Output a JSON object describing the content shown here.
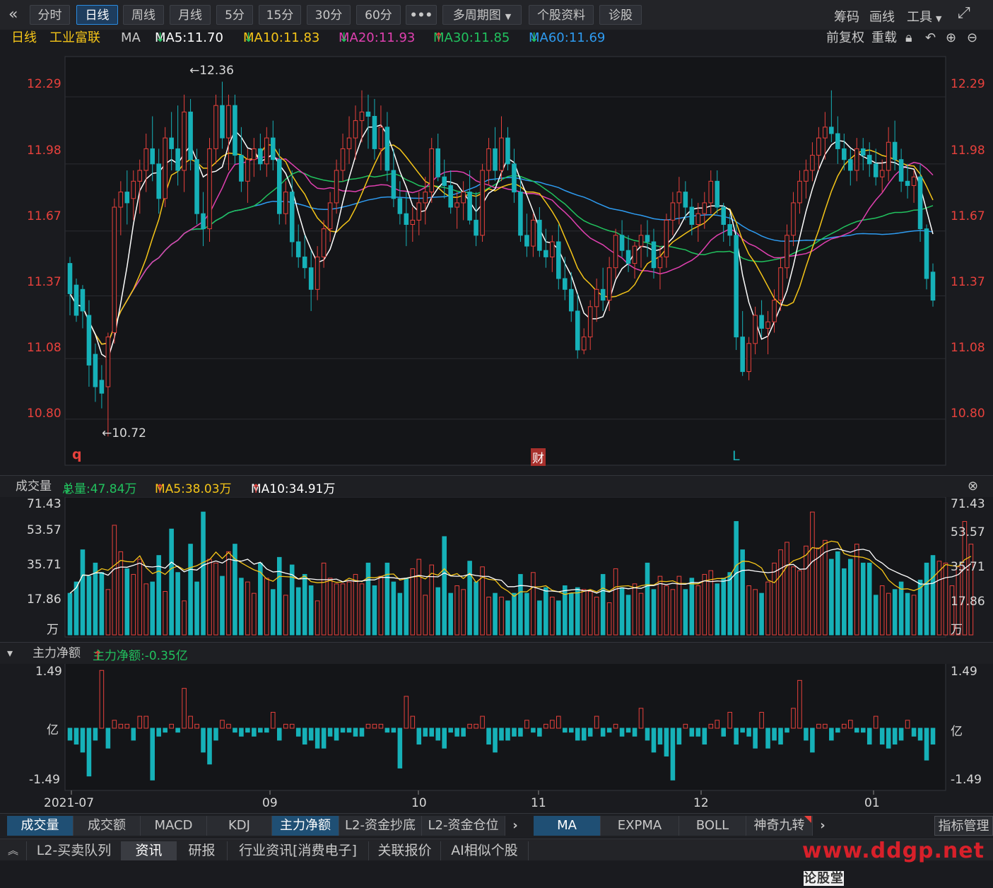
{
  "toolbar": {
    "collapse_icon": "double-chevron-left-icon",
    "buttons": [
      "分时",
      "日线",
      "周线",
      "月线",
      "5分",
      "15分",
      "30分",
      "60分",
      "•••",
      "多周期图",
      "个股资料",
      "诊股"
    ],
    "active": "日线",
    "right": [
      "筹码",
      "画线",
      "工具"
    ],
    "fullscreen_icon": "expand-icon"
  },
  "legend": {
    "period": "日线",
    "stock": "工业富联",
    "indicator": "MA",
    "ma5": "MA5:11.70",
    "ma10": "MA10:11.83",
    "ma20": "MA20:11.93",
    "ma30": "MA30:11.85",
    "ma60": "MA60:11.69",
    "adjust": "前复权",
    "reload": "重载",
    "colors": {
      "ma5": "#ffffff",
      "ma10": "#f5c518",
      "ma20": "#e040b0",
      "ma30": "#21c25e",
      "ma60": "#2e9bf0",
      "up": "#e8413c",
      "down": "#16b1b8"
    }
  },
  "price_axis": {
    "ticks": [
      "12.29",
      "11.98",
      "11.67",
      "11.37",
      "11.08",
      "10.80"
    ]
  },
  "annotations": {
    "high": "←12.36",
    "low": "←10.72",
    "marker_q": "q",
    "marker_cai": "财",
    "marker_l": "L"
  },
  "volume": {
    "title": "成交量",
    "total": "总量:47.84万",
    "ma5": "MA5:38.03万",
    "ma10": "MA10:34.91万",
    "ticks": [
      "71.43",
      "53.57",
      "35.71",
      "17.86"
    ],
    "unit": "万"
  },
  "netflow": {
    "title": "主力净额",
    "value": "主力净额:-0.35亿",
    "ticks": [
      "1.49",
      "-1.49"
    ],
    "unit": "亿"
  },
  "x_axis": {
    "labels": [
      "2021-07",
      "09",
      "10",
      "11",
      "12",
      "01"
    ]
  },
  "indicator_tabs": [
    "成交量",
    "成交额",
    "MACD",
    "KDJ",
    "主力净额",
    "L2-资金抄底",
    "L2-资金仓位"
  ],
  "indicator_active": [
    "成交量",
    "主力净额"
  ],
  "ma_tabs": [
    "MA",
    "EXPMA",
    "BOLL",
    "神奇九转"
  ],
  "ma_active": "MA",
  "index_manage": "指标管理",
  "bottom_tabs": [
    "L2-买卖队列",
    "资讯",
    "研报",
    "行业资讯[消费电子]",
    "关联报价",
    "AI相似个股"
  ],
  "bottom_active": "资讯",
  "watermark": "www.ddgp.net",
  "watermark_tail": "论股堂",
  "chart_data": {
    "type": "candlestick",
    "ylim": [
      10.62,
      12.45
    ],
    "candles": [
      [
        11.52,
        11.55,
        11.28,
        11.38
      ],
      [
        11.42,
        11.45,
        11.25,
        11.28
      ],
      [
        11.4,
        11.42,
        11.22,
        11.3
      ],
      [
        11.28,
        11.35,
        10.95,
        11.05
      ],
      [
        11.1,
        11.15,
        10.88,
        10.95
      ],
      [
        10.98,
        11.05,
        10.85,
        10.92
      ],
      [
        10.95,
        11.2,
        10.72,
        11.18
      ],
      [
        11.2,
        11.82,
        11.15,
        11.78
      ],
      [
        11.78,
        11.9,
        11.65,
        11.85
      ],
      [
        11.85,
        11.95,
        11.7,
        11.8
      ],
      [
        11.82,
        11.95,
        11.72,
        11.9
      ],
      [
        11.9,
        12.0,
        11.75,
        11.95
      ],
      [
        11.95,
        12.12,
        11.85,
        12.05
      ],
      [
        12.05,
        12.2,
        11.9,
        11.98
      ],
      [
        11.98,
        12.05,
        11.75,
        11.82
      ],
      [
        11.82,
        12.15,
        11.78,
        12.1
      ],
      [
        12.1,
        12.22,
        11.95,
        12.05
      ],
      [
        12.05,
        12.25,
        11.88,
        11.95
      ],
      [
        11.95,
        12.3,
        11.85,
        12.22
      ],
      [
        12.22,
        12.28,
        11.95,
        12.0
      ],
      [
        12.0,
        12.05,
        11.7,
        11.75
      ],
      [
        11.75,
        11.85,
        11.6,
        11.68
      ],
      [
        11.68,
        12.1,
        11.62,
        12.05
      ],
      [
        12.05,
        12.3,
        11.98,
        12.25
      ],
      [
        12.25,
        12.36,
        12.05,
        12.1
      ],
      [
        12.1,
        12.3,
        11.95,
        12.25
      ],
      [
        12.25,
        12.3,
        11.98,
        12.02
      ],
      [
        12.02,
        12.15,
        11.85,
        11.9
      ],
      [
        11.9,
        12.05,
        11.8,
        12.0
      ],
      [
        12.0,
        12.1,
        11.92,
        12.05
      ],
      [
        12.05,
        12.12,
        11.95,
        11.98
      ],
      [
        11.98,
        12.15,
        11.92,
        12.1
      ],
      [
        12.1,
        12.18,
        11.95,
        12.0
      ],
      [
        12.0,
        12.05,
        11.7,
        11.75
      ],
      [
        11.75,
        11.9,
        11.7,
        11.85
      ],
      [
        11.85,
        11.95,
        11.55,
        11.62
      ],
      [
        11.62,
        11.7,
        11.5,
        11.55
      ],
      [
        11.55,
        11.65,
        11.45,
        11.5
      ],
      [
        11.5,
        11.58,
        11.3,
        11.4
      ],
      [
        11.4,
        11.6,
        11.35,
        11.55
      ],
      [
        11.55,
        11.72,
        11.5,
        11.68
      ],
      [
        11.68,
        11.85,
        11.62,
        11.8
      ],
      [
        11.8,
        12.0,
        11.75,
        11.95
      ],
      [
        11.95,
        12.12,
        11.9,
        12.05
      ],
      [
        12.05,
        12.2,
        11.98,
        12.1
      ],
      [
        12.1,
        12.25,
        12.0,
        12.18
      ],
      [
        12.18,
        12.32,
        12.08,
        12.22
      ],
      [
        12.22,
        12.3,
        12.05,
        12.2
      ],
      [
        12.2,
        12.28,
        12.0,
        12.05
      ],
      [
        12.05,
        12.25,
        11.95,
        12.15
      ],
      [
        12.15,
        12.22,
        11.9,
        11.95
      ],
      [
        11.95,
        12.05,
        11.78,
        11.82
      ],
      [
        11.82,
        11.9,
        11.7,
        11.75
      ],
      [
        11.75,
        11.85,
        11.6,
        11.7
      ],
      [
        11.7,
        11.78,
        11.62,
        11.72
      ],
      [
        11.72,
        11.85,
        11.65,
        11.8
      ],
      [
        11.8,
        11.92,
        11.7,
        11.85
      ],
      [
        11.85,
        12.1,
        11.8,
        12.05
      ],
      [
        12.05,
        12.12,
        11.9,
        11.92
      ],
      [
        11.92,
        12.0,
        11.82,
        11.88
      ],
      [
        11.88,
        11.95,
        11.75,
        11.78
      ],
      [
        11.78,
        11.85,
        11.68,
        11.8
      ],
      [
        11.8,
        11.9,
        11.72,
        11.85
      ],
      [
        11.85,
        11.95,
        11.7,
        11.72
      ],
      [
        11.72,
        11.85,
        11.6,
        11.65
      ],
      [
        11.65,
        11.98,
        11.62,
        11.95
      ],
      [
        11.95,
        12.1,
        11.88,
        12.05
      ],
      [
        12.05,
        12.15,
        11.9,
        11.95
      ],
      [
        11.95,
        12.2,
        11.9,
        12.1
      ],
      [
        12.1,
        12.15,
        11.95,
        11.98
      ],
      [
        11.98,
        12.05,
        11.8,
        11.85
      ],
      [
        11.85,
        11.92,
        11.62,
        11.65
      ],
      [
        11.65,
        11.75,
        11.55,
        11.6
      ],
      [
        11.6,
        11.75,
        11.55,
        11.72
      ],
      [
        11.72,
        11.78,
        11.55,
        11.58
      ],
      [
        11.58,
        11.68,
        11.5,
        11.55
      ],
      [
        11.55,
        11.65,
        11.48,
        11.62
      ],
      [
        11.62,
        11.7,
        11.4,
        11.45
      ],
      [
        11.45,
        11.55,
        11.35,
        11.4
      ],
      [
        11.4,
        11.48,
        11.25,
        11.3
      ],
      [
        11.3,
        11.38,
        11.08,
        11.12
      ],
      [
        11.12,
        11.22,
        11.1,
        11.18
      ],
      [
        11.18,
        11.35,
        11.12,
        11.32
      ],
      [
        11.32,
        11.45,
        11.25,
        11.4
      ],
      [
        11.4,
        11.5,
        11.3,
        11.35
      ],
      [
        11.35,
        11.55,
        11.3,
        11.5
      ],
      [
        11.5,
        11.68,
        11.45,
        11.65
      ],
      [
        11.65,
        11.72,
        11.55,
        11.58
      ],
      [
        11.58,
        11.65,
        11.48,
        11.52
      ],
      [
        11.52,
        11.62,
        11.45,
        11.6
      ],
      [
        11.6,
        11.7,
        11.5,
        11.65
      ],
      [
        11.65,
        11.72,
        11.55,
        11.62
      ],
      [
        11.62,
        11.68,
        11.45,
        11.5
      ],
      [
        11.5,
        11.6,
        11.4,
        11.55
      ],
      [
        11.55,
        11.75,
        11.5,
        11.72
      ],
      [
        11.72,
        11.85,
        11.65,
        11.8
      ],
      [
        11.8,
        11.92,
        11.7,
        11.85
      ],
      [
        11.85,
        11.9,
        11.72,
        11.78
      ],
      [
        11.78,
        11.82,
        11.65,
        11.7
      ],
      [
        11.7,
        11.8,
        11.62,
        11.75
      ],
      [
        11.75,
        11.85,
        11.68,
        11.8
      ],
      [
        11.8,
        11.95,
        11.75,
        11.9
      ],
      [
        11.9,
        11.95,
        11.75,
        11.78
      ],
      [
        11.78,
        11.8,
        11.62,
        11.7
      ],
      [
        11.7,
        11.75,
        11.6,
        11.65
      ],
      [
        11.65,
        11.7,
        11.12,
        11.18
      ],
      [
        11.18,
        11.3,
        11.0,
        11.02
      ],
      [
        11.02,
        11.18,
        10.98,
        11.15
      ],
      [
        11.15,
        11.32,
        11.1,
        11.28
      ],
      [
        11.28,
        11.35,
        11.18,
        11.22
      ],
      [
        11.22,
        11.3,
        11.1,
        11.25
      ],
      [
        11.25,
        11.4,
        11.2,
        11.35
      ],
      [
        11.35,
        11.55,
        11.3,
        11.5
      ],
      [
        11.5,
        11.7,
        11.45,
        11.65
      ],
      [
        11.65,
        11.85,
        11.6,
        11.8
      ],
      [
        11.8,
        11.95,
        11.75,
        11.9
      ],
      [
        11.9,
        12.0,
        11.82,
        11.95
      ],
      [
        11.95,
        12.08,
        11.9,
        12.02
      ],
      [
        12.02,
        12.15,
        11.95,
        12.1
      ],
      [
        12.1,
        12.22,
        12.0,
        12.15
      ],
      [
        12.15,
        12.32,
        12.08,
        12.12
      ],
      [
        12.12,
        12.2,
        11.98,
        12.05
      ],
      [
        12.05,
        12.12,
        11.95,
        12.0
      ],
      [
        12.0,
        12.05,
        11.88,
        11.95
      ],
      [
        11.95,
        12.1,
        11.9,
        12.05
      ],
      [
        12.05,
        12.1,
        11.95,
        12.02
      ],
      [
        12.02,
        12.08,
        11.92,
        11.98
      ],
      [
        11.98,
        12.05,
        11.88,
        11.92
      ],
      [
        11.92,
        12.0,
        11.85,
        11.95
      ],
      [
        11.95,
        12.15,
        11.9,
        12.08
      ],
      [
        12.08,
        12.18,
        11.95,
        12.0
      ],
      [
        12.0,
        12.05,
        11.85,
        11.9
      ],
      [
        11.9,
        11.98,
        11.82,
        11.88
      ],
      [
        11.88,
        11.95,
        11.8,
        11.92
      ],
      [
        11.92,
        11.98,
        11.62,
        11.68
      ],
      [
        11.68,
        11.7,
        11.4,
        11.45
      ],
      [
        11.48,
        11.52,
        11.32,
        11.35
      ]
    ],
    "volume_wan": [
      22,
      28,
      45,
      31,
      38,
      33,
      24,
      58,
      44,
      35,
      32,
      40,
      27,
      28,
      42,
      23,
      56,
      33,
      18,
      48,
      28,
      65,
      40,
      38,
      31,
      44,
      48,
      30,
      28,
      22,
      38,
      30,
      24,
      41,
      21,
      37,
      25,
      32,
      26,
      18,
      38,
      30,
      27,
      27,
      28,
      32,
      27,
      38,
      26,
      31,
      38,
      28,
      22,
      30,
      35,
      40,
      21,
      37,
      25,
      52,
      22,
      26,
      24,
      39,
      28,
      36,
      20,
      22,
      20,
      18,
      22,
      32,
      22,
      33,
      18,
      25,
      20,
      18,
      26,
      22,
      25,
      24,
      23,
      20,
      32,
      17,
      35,
      25,
      21,
      27,
      22,
      38,
      24,
      31,
      26,
      24,
      31,
      24,
      30,
      26,
      32,
      34,
      27,
      30,
      33,
      60,
      45,
      26,
      24,
      22,
      28,
      38,
      45,
      49,
      36,
      34,
      47,
      65,
      46,
      50,
      40,
      44,
      35,
      40,
      48,
      38,
      38,
      21,
      26,
      22,
      24,
      28,
      22,
      21,
      29,
      38,
      42,
      39,
      38,
      26,
      36,
      60,
      48
    ],
    "netflow_yi": [
      -0.3,
      -0.4,
      -0.6,
      -1.2,
      -0.3,
      1.45,
      -0.5,
      0.2,
      0.1,
      0.1,
      -0.3,
      0.3,
      0.3,
      -1.3,
      -0.2,
      -0.1,
      0.1,
      -0.1,
      1.0,
      0.3,
      0.1,
      -0.6,
      -0.9,
      -0.3,
      0.2,
      0.1,
      -0.1,
      -0.2,
      -0.1,
      -0.2,
      -0.1,
      -0.1,
      0.4,
      -0.3,
      0.1,
      0.1,
      -0.2,
      -0.4,
      -0.3,
      -0.5,
      -0.5,
      -0.2,
      -0.3,
      -0.1,
      -0.1,
      -0.2,
      -0.2,
      0.1,
      0.1,
      0.1,
      -0.1,
      -0.1,
      -1.0,
      0.8,
      0.3,
      -0.4,
      -0.2,
      -0.2,
      -0.3,
      -0.5,
      -0.1,
      -0.2,
      -0.2,
      0.1,
      0.1,
      0.3,
      -0.4,
      -0.6,
      -0.3,
      -0.3,
      -0.2,
      -0.2,
      0.2,
      -0.1,
      -0.2,
      0.1,
      0.2,
      0.3,
      -0.1,
      -0.1,
      -0.3,
      -0.3,
      -0.2,
      0.3,
      -0.2,
      -0.1,
      0.1,
      -0.2,
      -0.1,
      -0.2,
      0.5,
      -0.3,
      -0.6,
      -0.4,
      -0.7,
      -1.3,
      -0.4,
      0.1,
      -0.2,
      -0.2,
      -0.4,
      0.1,
      0.2,
      -0.2,
      0.4,
      -0.4,
      -0.1,
      -0.2,
      -0.5,
      0.4,
      -0.5,
      -0.3,
      -0.4,
      -0.1,
      0.5,
      1.2,
      -0.3,
      -0.6,
      0.1,
      0.1,
      -0.3,
      -0.1,
      0.1,
      0.2,
      -0.1,
      -0.1,
      -0.4,
      0.3,
      -0.4,
      -0.5,
      -0.4,
      -0.3,
      0.2,
      -0.2,
      -0.3,
      -0.8,
      -0.4
    ]
  }
}
